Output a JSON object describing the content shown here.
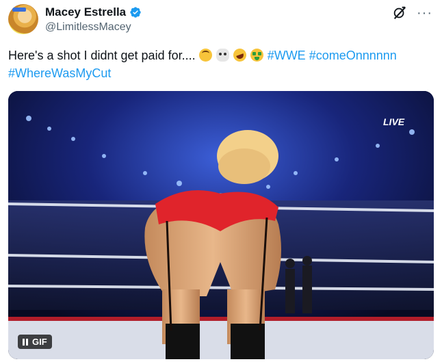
{
  "author": {
    "display_name": "Macey Estrella",
    "handle": "@LimitlessMacey",
    "verified": true
  },
  "tweet": {
    "text_plain": "Here's a shot I didnt get paid for....",
    "emojis": [
      "upside-down-face",
      "skull-and-crossbones",
      "rolling-on-floor-laughing",
      "money-mouth-face"
    ],
    "hashtags": [
      "#WWE",
      "#comeOnnnnnn",
      "#WhereWasMyCut"
    ]
  },
  "media": {
    "type": "GIF",
    "badge_label": "GIF",
    "overlay_text": "LIVE"
  },
  "icons": {
    "grok": "grok-icon",
    "more": "more-icon",
    "verified": "verified-badge-icon",
    "pause": "pause-icon"
  },
  "colors": {
    "hashtag": "#1d9bf0",
    "verified": "#1d9bf0",
    "secondary_text": "#536471"
  }
}
